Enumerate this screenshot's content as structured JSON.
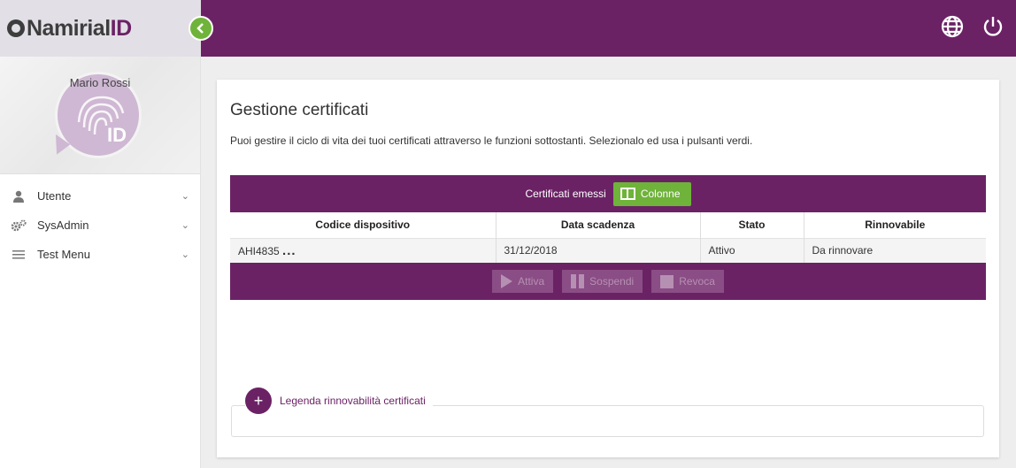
{
  "brand": {
    "name_part1": "Namirial",
    "name_part2": "ID"
  },
  "user": {
    "name": "Mario Rossi"
  },
  "sidebar": {
    "items": [
      {
        "label": "Utente",
        "icon": "user-icon"
      },
      {
        "label": "SysAdmin",
        "icon": "gears-icon"
      },
      {
        "label": "Test Menu",
        "icon": "list-icon"
      }
    ]
  },
  "topbar": {
    "icons": [
      "globe-icon",
      "power-icon"
    ]
  },
  "page": {
    "title": "Gestione certificati",
    "description": "Puoi gestire il ciclo di vita dei tuoi certificati attraverso le funzioni sottostanti. Selezionalo ed usa i pulsanti verdi."
  },
  "table": {
    "header_title": "Certificati emessi",
    "columns_button": "Colonne",
    "columns": [
      "Codice dispositivo",
      "Data scadenza",
      "Stato",
      "Rinnovabile"
    ],
    "rows": [
      {
        "code": "AHI4835",
        "more": "...",
        "expiry": "31/12/2018",
        "status": "Attivo",
        "renewable": "Da rinnovare"
      }
    ],
    "actions": [
      "Attiva",
      "Sospendi",
      "Revoca"
    ]
  },
  "legend": {
    "label": "Legenda rinnovabilità certificati",
    "button": "+"
  },
  "colors": {
    "primary": "#6b2265",
    "accent": "#6fb33a"
  }
}
